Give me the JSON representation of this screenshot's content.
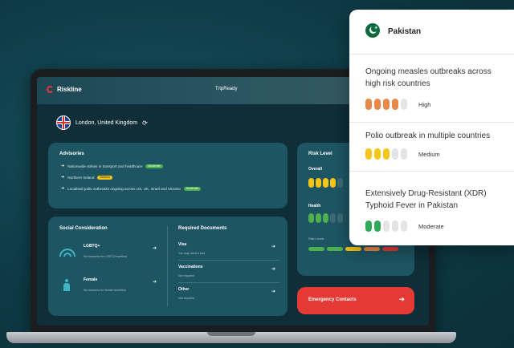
{
  "app": {
    "brand": "Riskline",
    "center_title": "TripReady"
  },
  "location": {
    "name": "London, United Kingdom",
    "refresh_icon": "refresh-icon"
  },
  "advisories": {
    "title": "Advisories",
    "items": [
      {
        "text": "Nationwide strikes in transport and healthcare",
        "tag": "Moderate",
        "tag_color": "#4caf50"
      },
      {
        "text": "Northern Ireland",
        "tag": "Medium",
        "tag_color": "#f5c518"
      },
      {
        "text": "Localised polio outbreaks ongoing across US, UK, Israel and Ukraine",
        "tag": "Moderate",
        "tag_color": "#4caf50"
      }
    ]
  },
  "social": {
    "title": "Social Consideration",
    "items": [
      {
        "label": "LGBTQ+",
        "sub": "No concerns for LGBTQ travellers"
      },
      {
        "label": "Female",
        "sub": "No concerns for female travellers"
      }
    ]
  },
  "documents": {
    "title": "Required Documents",
    "items": [
      {
        "label": "Visa",
        "sub": "You may need a visa"
      },
      {
        "label": "Vaccinations",
        "sub": "Not required"
      },
      {
        "label": "Other",
        "sub": "Not required"
      }
    ]
  },
  "risk": {
    "title": "Risk Level",
    "overall_label": "Overall",
    "overall_level": 4,
    "health_label": "Health",
    "health_level": 3,
    "legend_label": "Risk Levels",
    "legend_colors": [
      "#4caf50",
      "#4caf50",
      "#f5c518",
      "#e8894a",
      "#e53935"
    ]
  },
  "emergency": {
    "label": "Emergency Contacts"
  },
  "popup": {
    "country": "Pakistan",
    "threats": [
      {
        "title": "Ongoing measles outbreaks across high risk countries",
        "level": "High",
        "filled": 4,
        "color": "#e8894a"
      },
      {
        "title": "Polio outbreak in multiple countries",
        "level": "Medium",
        "filled": 3,
        "color": "#f5c518"
      },
      {
        "title": "Extensively Drug-Resistant (XDR) Typhoid Fever in Pakistan",
        "level": "Moderate",
        "filled": 2,
        "color": "#2faa5a"
      }
    ]
  },
  "colors": {
    "background": "#0e3a45",
    "accent_red": "#e53935",
    "risk_yellow": "#f5c518",
    "risk_green": "#4caf50"
  }
}
